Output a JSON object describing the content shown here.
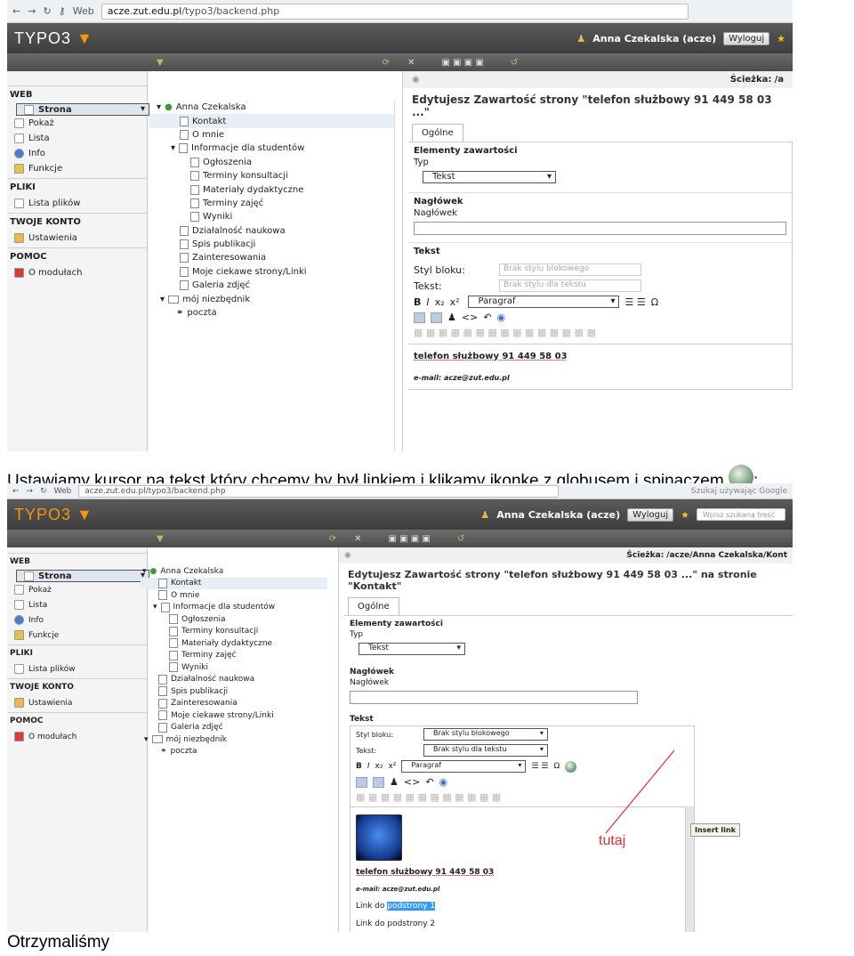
{
  "browser": {
    "nav_label": "Web",
    "url_host": "acze.zut.edu.pl",
    "url_path": "/typo3/backend.php",
    "search_placeholder": "Szukaj używając Google"
  },
  "typo3": {
    "logo_text": "TYPO3",
    "user": "Anna Czekalska (acze)",
    "logout": "Wyloguj",
    "search_placeholder": "Wpisz szukaną treść",
    "path_label": "Ścieżka:",
    "path_value": "/acze/Anna Czekalska/",
    "path_value_top": "/a",
    "path_tail": "Kont"
  },
  "menu": {
    "web": "WEB",
    "strona": "Strona",
    "pokaz": "Pokaż",
    "lista": "Lista",
    "info": "Info",
    "funkcje": "Funkcje",
    "pliki": "PLIKI",
    "lista_plikow": "Lista plików",
    "konto": "TWOJE KONTO",
    "ustawienia": "Ustawienia",
    "pomoc": "POMOC",
    "o_modulach": "O modułach"
  },
  "tree": [
    "Anna Czekalska",
    "Kontakt",
    "O mnie",
    "Informacje dla studentów",
    "Ogłoszenia",
    "Terminy konsultacji",
    "Materiały dydaktyczne",
    "Terminy zajęć",
    "Wyniki",
    "Działalność naukowa",
    "Spis publikacji",
    "Zainteresowania",
    "Moje ciekawe strony/Linki",
    "Galeria zdjęć",
    "mój niezbędnik",
    "poczta"
  ],
  "editor": {
    "title_top": "Edytujesz Zawartość strony \"telefon służbowy 91 449 58 03 ...\"",
    "title_bottom": "Edytujesz Zawartość strony \"telefon służbowy 91 449 58 03 ...\" na stronie \"Kontakt\"",
    "tab": "Ogólne",
    "elementy": "Elementy zawartości",
    "typ_label": "Typ",
    "typ_value": "Tekst",
    "naglowek_section": "Nagłówek",
    "naglowek_label": "Nagłówek",
    "tekst_section": "Tekst",
    "styl_bloku": "Styl bloku:",
    "styl_bloku_value": "Brak stylu blokowego",
    "tekst_label": "Tekst:",
    "tekst_value": "Brak stylu dla tekstu",
    "paragraf": "Paragraf",
    "phone": "telefon służbowy 91 449 58 03",
    "email": "e-mail: acze@zut.edu.pl",
    "link1_prefix": "Link do ",
    "link1_selected": "podstrony 1",
    "link2": "Link do podstrony 2",
    "tooltip": "Insert link",
    "annotation": "tutaj"
  },
  "captions": {
    "main_text": "Ustawiamy kursor na tekst  który chcemy by był linkiem i klikamy ikonkę z globusem i spinaczem",
    "main_suffix": ":",
    "bottom": "Otrzymaliśmy"
  },
  "colors": {
    "topbar": "#4a4a4a",
    "logo_accent": "#f49700",
    "selection": "#3399ff",
    "annotation": "#e0312c"
  }
}
